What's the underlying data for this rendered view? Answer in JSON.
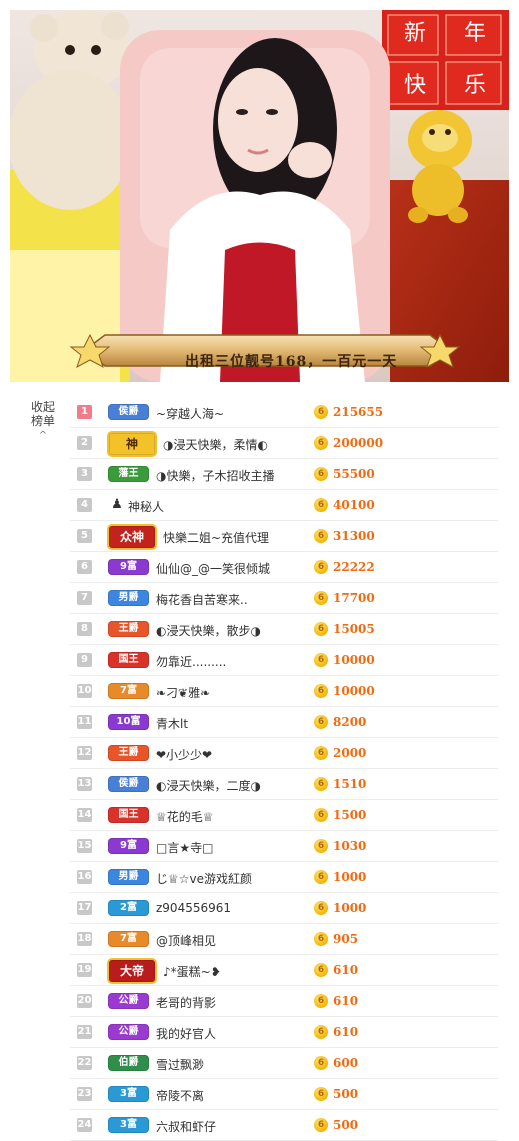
{
  "stream": {
    "caption": "出租三位靓号168，一百元一天"
  },
  "sidebar": {
    "collapse_label_1": "收起",
    "collapse_label_2": "榜单",
    "chevron_icon": "chevron-up-icon"
  },
  "coin_symbol": "6",
  "colors": {
    "amount": "#f06a10",
    "rank_top": "#f07c8a",
    "rank_default": "#c8c8c8"
  },
  "leaderboard": [
    {
      "rank": "1",
      "badge": "侯爵",
      "badge_color": "#4a7fd8",
      "name": "~穿越人海~",
      "amount": "215655"
    },
    {
      "rank": "2",
      "badge": "神",
      "badge_color": "#f3c229",
      "name": "◑浸天快樂，柔情◐",
      "amount": "200000"
    },
    {
      "rank": "3",
      "badge": "藩王",
      "badge_color": "#3b9a3b",
      "name": "◑快樂，子木招收主播",
      "amount": "55500"
    },
    {
      "rank": "4",
      "badge": "",
      "badge_color": "",
      "name": "神秘人",
      "amount": "40100"
    },
    {
      "rank": "5",
      "badge": "众神",
      "badge_color": "#c2231d",
      "name": "快樂二姐~充值代理",
      "amount": "31300"
    },
    {
      "rank": "6",
      "badge": "9富",
      "badge_color": "#8a3ad0",
      "name": "仙仙@_@一笑很倾城",
      "amount": "22222"
    },
    {
      "rank": "7",
      "badge": "男爵",
      "badge_color": "#3d86e0",
      "name": "梅花香自苦寒来..",
      "amount": "17700"
    },
    {
      "rank": "8",
      "badge": "王爵",
      "badge_color": "#e8552a",
      "name": "◐浸天快樂，散步◑",
      "amount": "15005"
    },
    {
      "rank": "9",
      "badge": "国王",
      "badge_color": "#d9322a",
      "name": "勿靠近.........",
      "amount": "10000"
    },
    {
      "rank": "10",
      "badge": "7富",
      "badge_color": "#e8892a",
      "name": "❧刁❦雅❧",
      "amount": "10000"
    },
    {
      "rank": "11",
      "badge": "10富",
      "badge_color": "#8a3ad0",
      "name": "青木lt",
      "amount": "8200"
    },
    {
      "rank": "12",
      "badge": "王爵",
      "badge_color": "#e8552a",
      "name": "❤小少少❤",
      "amount": "2000"
    },
    {
      "rank": "13",
      "badge": "侯爵",
      "badge_color": "#4a7fd8",
      "name": "◐浸天快樂，二度◑",
      "amount": "1510"
    },
    {
      "rank": "14",
      "badge": "国王",
      "badge_color": "#d9322a",
      "name": "♕花的毛♕",
      "amount": "1500"
    },
    {
      "rank": "15",
      "badge": "9富",
      "badge_color": "#8a3ad0",
      "name": "□言★寺□",
      "amount": "1030"
    },
    {
      "rank": "16",
      "badge": "男爵",
      "badge_color": "#3d86e0",
      "name": "じ♕☆ve游戏紅颜",
      "amount": "1000"
    },
    {
      "rank": "17",
      "badge": "2富",
      "badge_color": "#2a9ad6",
      "name": "z904556961",
      "amount": "1000"
    },
    {
      "rank": "18",
      "badge": "7富",
      "badge_color": "#e8892a",
      "name": "@顶峰相见",
      "amount": "905"
    },
    {
      "rank": "19",
      "badge": "大帝",
      "badge_color": "#b81c1c",
      "name": "♪*蛋糕~❥",
      "amount": "610"
    },
    {
      "rank": "20",
      "badge": "公爵",
      "badge_color": "#9b3ad0",
      "name": "老哥的背影",
      "amount": "610"
    },
    {
      "rank": "21",
      "badge": "公爵",
      "badge_color": "#9b3ad0",
      "name": "我的好官人",
      "amount": "610"
    },
    {
      "rank": "22",
      "badge": "伯爵",
      "badge_color": "#2f8f4a",
      "name": "雪过飘渺",
      "amount": "600"
    },
    {
      "rank": "23",
      "badge": "3富",
      "badge_color": "#2a9ad6",
      "name": "帝陵不离",
      "amount": "500"
    },
    {
      "rank": "24",
      "badge": "3富",
      "badge_color": "#2a9ad6",
      "name": "六叔和虾仔",
      "amount": "500"
    }
  ]
}
